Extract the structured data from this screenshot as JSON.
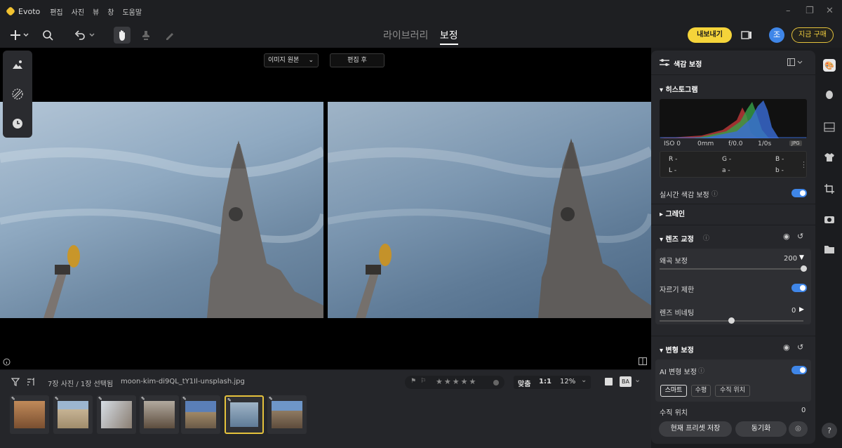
{
  "app": {
    "name": "Evoto",
    "menu": [
      "편집",
      "사진",
      "뷰",
      "창",
      "도움말"
    ]
  },
  "toolbar": {
    "tabs": [
      {
        "label": "라이브러리"
      },
      {
        "label": "보정"
      }
    ],
    "export_label": "내보내기",
    "avatar_initial": "조",
    "buy_label": "지금 구매"
  },
  "canvas": {
    "before_label": "이미지 원본",
    "after_label": "편집 후"
  },
  "filmstrip": {
    "count_text": "7장 사진 / 1장 선택됨",
    "filename": "moon-kim-di9QL_tY1Il-unsplash.jpg",
    "fit_label": "맞춤",
    "one_to_one": "1:1",
    "zoom": "12%"
  },
  "panel": {
    "title": "색감 보정",
    "histogram": {
      "label": "히스토그램",
      "iso": "ISO 0",
      "focal": "0mm",
      "aperture": "f/0.0",
      "shutter": "1/0s",
      "format": "JPG",
      "r": "R -",
      "g": "G -",
      "b": "B -",
      "l": "L -",
      "a": "a -",
      "bb": "b -"
    },
    "realtime_label": "실시간 색감 보정",
    "grain_label": "그레인",
    "lens": {
      "label": "렌즈 교정",
      "distortion_label": "왜곡 보정",
      "distortion_value": "200",
      "distortion_level": 1.0,
      "crop_label": "자르기 제한",
      "vignette_label": "렌즈 비네팅",
      "vignette_value": "0",
      "vignette_level": 0.5
    },
    "transform": {
      "label": "변형 보정",
      "ai_label": "AI 변형 보정",
      "chips": [
        "스마트",
        "수평",
        "수직 위치"
      ],
      "vertical_label": "수직 위치",
      "vertical_value": "0"
    },
    "save_preset": "현재 프리셋 저장",
    "sync": "동기화"
  }
}
